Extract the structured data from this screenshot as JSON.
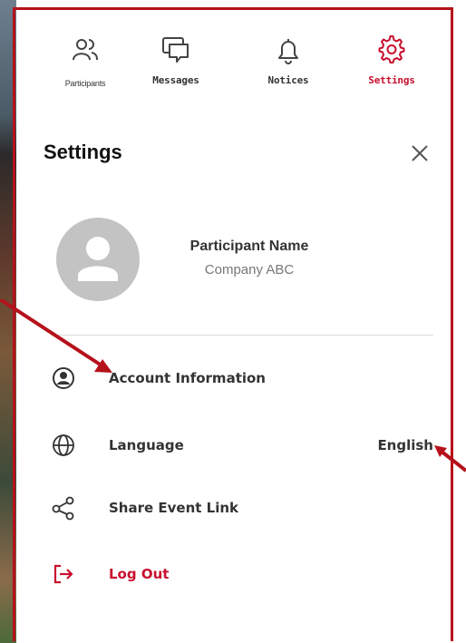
{
  "nav": {
    "participants": "Participants",
    "messages": "Messages",
    "notices": "Notices",
    "settings": "Settings"
  },
  "panel": {
    "title": "Settings"
  },
  "profile": {
    "name": "Participant Name",
    "company": "Company ABC"
  },
  "menu": {
    "account": "Account Information",
    "language": "Language",
    "language_value": "English",
    "share": "Share Event Link",
    "logout": "Log Out"
  },
  "colors": {
    "accent": "#c8102e",
    "annotation": "#b5121b"
  }
}
